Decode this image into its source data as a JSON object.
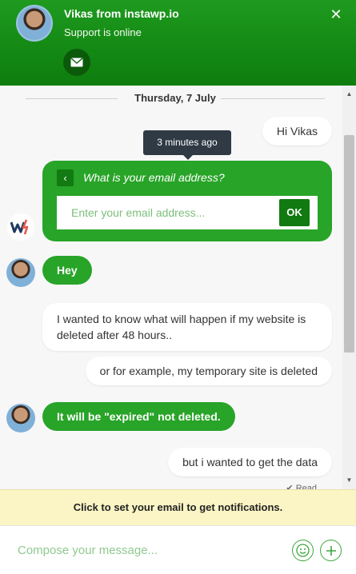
{
  "header": {
    "title": "Vikas from instawp.io",
    "subtitle": "Support is online",
    "close_label": "✕",
    "mail_icon": "mail-icon"
  },
  "conversation": {
    "date": "Thursday, 7 July",
    "tooltip": "3 minutes ago",
    "messages": [
      {
        "from": "user",
        "text": "Hi Vikas"
      },
      {
        "from": "agent",
        "text": "Hey"
      },
      {
        "from": "user",
        "text": "I wanted to know what will happen if my website is deleted after 48 hours.."
      },
      {
        "from": "user",
        "text": "or for example, my temporary site is deleted"
      },
      {
        "from": "agent",
        "text": "It will be \"expired\" not deleted."
      },
      {
        "from": "user",
        "text": "but i wanted to get the data"
      }
    ],
    "read_status": "✔ Read"
  },
  "email_form": {
    "prompt": "What is your email address?",
    "placeholder": "Enter your email address...",
    "ok_label": "OK",
    "back_label": "‹"
  },
  "notification_bar": {
    "text": "Click to set your email to get notifications."
  },
  "composer": {
    "placeholder": "Compose your message...",
    "emoji_icon": "smiley-icon",
    "add_icon": "plus-icon"
  },
  "colors": {
    "brand_green": "#28a428",
    "dark_green": "#117a11",
    "notify_bg": "#fbf5c5"
  }
}
